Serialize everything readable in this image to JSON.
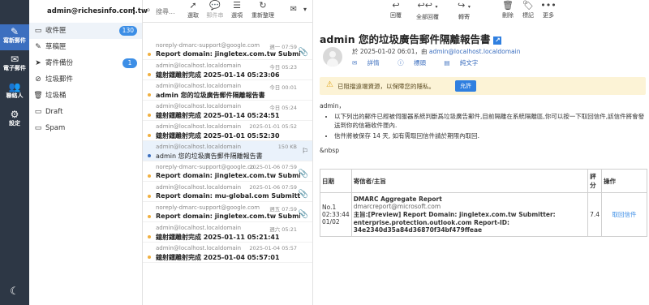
{
  "rail": {
    "items": [
      {
        "label": "寫新郵件",
        "icon": "compose-icon"
      },
      {
        "label": "電子郵件",
        "icon": "mail-icon"
      },
      {
        "label": "聯絡人",
        "icon": "contacts-icon"
      },
      {
        "label": "設定",
        "icon": "gear-icon"
      }
    ],
    "theme_icon": "moon-icon"
  },
  "account": {
    "email": "admin@richesinfo.com.tw",
    "menu_icon": "⋮"
  },
  "folders": [
    {
      "label": "收件匣",
      "badge": "130",
      "icon": "inbox-icon"
    },
    {
      "label": "草稿匣",
      "icon": "pencil-icon"
    },
    {
      "label": "寄件備份",
      "badge": "1",
      "icon": "send-icon"
    },
    {
      "label": "垃圾郵件",
      "icon": "spam-icon"
    },
    {
      "label": "垃圾桶",
      "icon": "trash-icon"
    },
    {
      "label": "Draft",
      "icon": "folder-icon"
    },
    {
      "label": "Spam",
      "icon": "folder-icon"
    }
  ],
  "search": {
    "placeholder": "搜尋..."
  },
  "toolbar_left": {
    "select": "選取",
    "thread": "郵件串",
    "options": "選項",
    "refresh": "重新整理"
  },
  "toolbar_right": {
    "reply": "回覆",
    "reply_all": "全部回覆",
    "forward": "轉寄",
    "delete": "刪除",
    "mark": "標記",
    "more": "更多"
  },
  "messages": [
    {
      "from": "noreply-dmarc-support@google.com",
      "date": "週一 07:59",
      "subject": "Report domain: jingletex.com.tw Submitter: google.com",
      "attach": true
    },
    {
      "from": "admin@localhost.localdomain",
      "date": "今日 05:23",
      "subject": "鐿射鐳雕射完成 2025-01-14 05:23:06"
    },
    {
      "from": "admin@localhost.localdomain",
      "date": "今日 00:01",
      "subject": "admin 您的垃圾廣告郵件隔離報告書"
    },
    {
      "from": "admin@localhost.localdomain",
      "date": "今日 05:24",
      "subject": "鐿射鐳雕射完成 2025-01-14 05:24:51"
    },
    {
      "from": "admin@localhost.localdomain",
      "date": "2025-01-01 05:52",
      "subject": "鐿射鐳雕射完成 2025-01-01 05:52:30"
    },
    {
      "from": "admin@localhost.localdomain",
      "date": "150 KB",
      "subject": "admin 您的垃圾廣告郵件隔離報告書",
      "selected": true,
      "flag": true
    },
    {
      "from": "noreply-dmarc-support@google.co...",
      "date": "2025-01-06 07:59",
      "subject": "Report domain: jingletex.com.tw Submitter: google.com",
      "attach": true
    },
    {
      "from": "admin@localhost.localdomain",
      "date": "2025-01-06 07:59",
      "subject": "Report domain: mu-global.com Submitter: google.com",
      "attach": true
    },
    {
      "from": "noreply-dmarc-support@google.com",
      "date": "週五 07:59",
      "subject": "Report domain: jingletex.com.tw Submitter: google.com",
      "attach": true
    },
    {
      "from": "admin@localhost.localdomain",
      "date": "週六 05:21",
      "subject": "鐿射鐳雕射完成 2025-01-11 05:21:41"
    },
    {
      "from": "admin@localhost.localdomain",
      "date": "2025-01-04 05:57",
      "subject": "鐿射鐳雕射完成 2025-01-04 05:57:01"
    }
  ],
  "view": {
    "title": "admin 您的垃圾廣告郵件隔離報告書",
    "date_line": "於 2025-01-02 06:01，由",
    "sender": "admin@localhost.localdomain",
    "details": "詳情",
    "headers": "標頭",
    "plain": "純文字",
    "warning": "已阻擋遠端資源，以保障您的隱私。",
    "allow": "允許",
    "greeting": "admin，",
    "bullets": [
      "以下列出的郵件已經被伺服器系統判斷爲垃圾廣告郵件,目前隔離在系統隔離區,你可以按一下取回信件,該信件將會發送到你的信箱收件匣內.",
      "信件將被保存 14 天, 如有需取回信件請於期限內取回."
    ],
    "nbsp": "&nbsp",
    "table": {
      "headers": [
        "日期",
        "寄信者/主旨",
        "評分",
        "操作"
      ],
      "rows": [
        {
          "date": [
            "No.1",
            "02:33:44",
            "01/02"
          ],
          "title": "DMARC Aggregate Report",
          "sender": "dmarcreport@microsoft.com",
          "subject": "主旨:[Preview] Report Domain: jingletex.com.tw Submitter: enterprise.protection.outlook.com Report-ID: 34e2340d35a84d36870f34bf479ffeae",
          "score": "7.4",
          "action": "取回信件"
        }
      ]
    }
  }
}
